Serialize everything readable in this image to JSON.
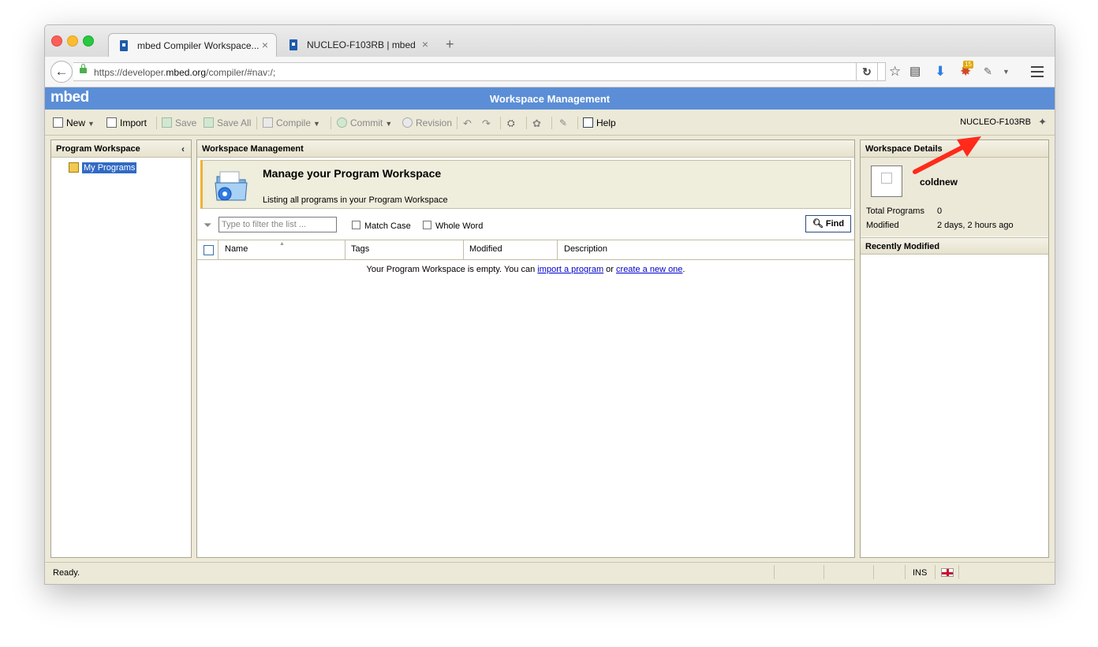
{
  "browser": {
    "tabs": [
      {
        "title": "mbed Compiler Workspace...",
        "close": "×"
      },
      {
        "title": "NUCLEO-F103RB | mbed",
        "close": "×"
      }
    ],
    "new_tab": "+",
    "url_prefix": "https://developer.",
    "url_domain": "mbed.org",
    "url_path": "/compiler/#nav:/;",
    "extension_badge": "15"
  },
  "app": {
    "logo": "mbed",
    "title": "Workspace Management",
    "accent_color": "#5b8ed6"
  },
  "toolbar": {
    "new": "New",
    "import": "Import",
    "save": "Save",
    "save_all": "Save All",
    "compile": "Compile",
    "commit": "Commit",
    "revision": "Revision",
    "help": "Help",
    "platform": "NUCLEO-F103RB"
  },
  "left_panel": {
    "title": "Program Workspace",
    "collapse": "‹",
    "tree": [
      {
        "label": "My Programs",
        "selected": true
      }
    ]
  },
  "main_panel": {
    "title": "Workspace Management",
    "banner_title": "Manage your Program Workspace",
    "banner_subtitle": "Listing all programs in your Program Workspace",
    "filter_placeholder": "Type to filter the list ...",
    "match_case": "Match Case",
    "whole_word": "Whole Word",
    "find": "Find",
    "columns": [
      "Name",
      "Tags",
      "Modified",
      "Description"
    ],
    "empty_prefix": "Your Program Workspace is empty. You can ",
    "empty_link1": "import a program",
    "empty_mid": " or ",
    "empty_link2": "create a new one",
    "empty_suffix": "."
  },
  "right_panel": {
    "title": "Workspace Details",
    "username": "coldnew",
    "total_programs_label": "Total Programs",
    "total_programs_value": "0",
    "modified_label": "Modified",
    "modified_value": "2 days, 2 hours ago",
    "recent_title": "Recently Modified"
  },
  "statusbar": {
    "text": "Ready.",
    "ins": "INS"
  },
  "annotation": {
    "arrow_color": "#ff2a1a"
  }
}
